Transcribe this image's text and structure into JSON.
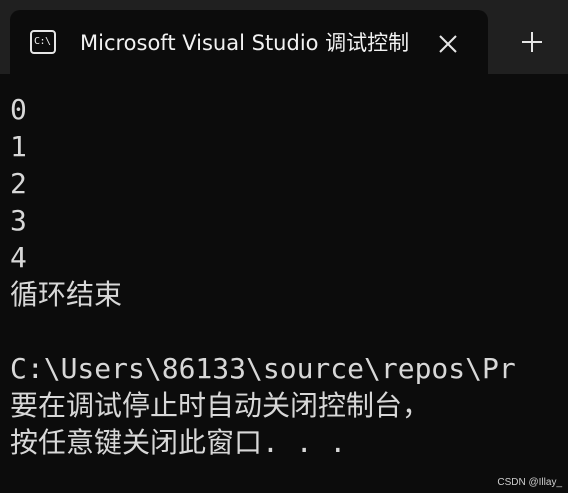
{
  "window": {
    "tab_title": "Microsoft Visual Studio 调试控制台",
    "tab_icon_text": "C:\\",
    "tab_icon": "terminal-icon",
    "close_icon": "close-icon",
    "new_tab_icon": "plus-icon"
  },
  "console": {
    "lines": [
      "0",
      "1",
      "2",
      "3",
      "4",
      "循环结束",
      "",
      "C:\\Users\\86133\\source\\repos\\Pr",
      "要在调试停止时自动关闭控制台，",
      "按任意键关闭此窗口. . ."
    ]
  },
  "watermark": "CSDN @Illay_"
}
